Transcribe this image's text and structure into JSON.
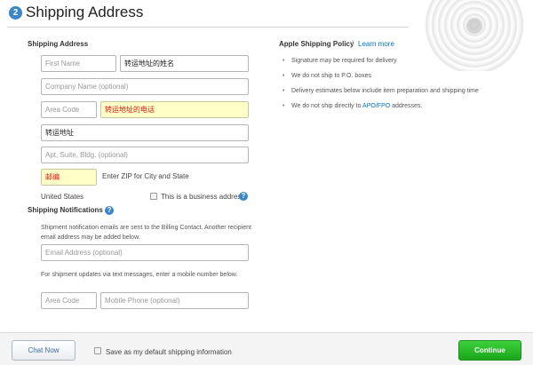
{
  "header": {
    "step_number": "2",
    "title": "Shipping Address"
  },
  "shipping_address": {
    "section_label": "Shipping Address",
    "first_name_placeholder": "First Name",
    "last_name_value": "转运地址的姓名",
    "company_placeholder": "Company Name (optional)",
    "area_code_placeholder": "Area Code",
    "phone_value": "转运地址的电话",
    "street_value": "转运地址",
    "apt_placeholder": "Apt, Suite, Bldg. (optional)",
    "zip_value": "邮编",
    "zip_hint": "Enter ZIP for City and State",
    "country": "United States",
    "business_checkbox_label": "This is a business address",
    "help_glyph": "?"
  },
  "shipping_notifications": {
    "section_label": "Shipping Notifications",
    "help_glyph": "?",
    "email_note": "Shipment notification emails are sent to the Billing Contact. Another recipient email address may be added below.",
    "email_placeholder": "Email Address (optional)",
    "sms_note": "For shipment updates via text messages, enter a mobile number below.",
    "area_code_placeholder": "Area Code",
    "mobile_placeholder": "Mobile Phone (optional)"
  },
  "policy": {
    "title": "Apple Shipping Policy",
    "separator": "|",
    "learn_more": "Learn more",
    "items": [
      "Signature may be required for delivery",
      "We do not ship to P.O. boxes",
      "Delivery estimates below include item preparation and shipping time"
    ],
    "last_item_prefix": "We do not ship directly to ",
    "last_item_link": "APO/FPO",
    "last_item_suffix": " addresses."
  },
  "footer": {
    "chat_label": "Chat Now",
    "default_checkbox_label": "Save as my default shipping information",
    "continue_label": "Continue"
  },
  "colors": {
    "accent_blue": "#3a86c8",
    "link_blue": "#0070c9",
    "warning_fill": "#ffffc8",
    "warning_text": "#dd1111",
    "continue_green": "#19a619"
  },
  "icons": {
    "step": "step-number-badge-icon",
    "help": "help-question-icon",
    "decoration": "swirl-decoration-icon"
  }
}
